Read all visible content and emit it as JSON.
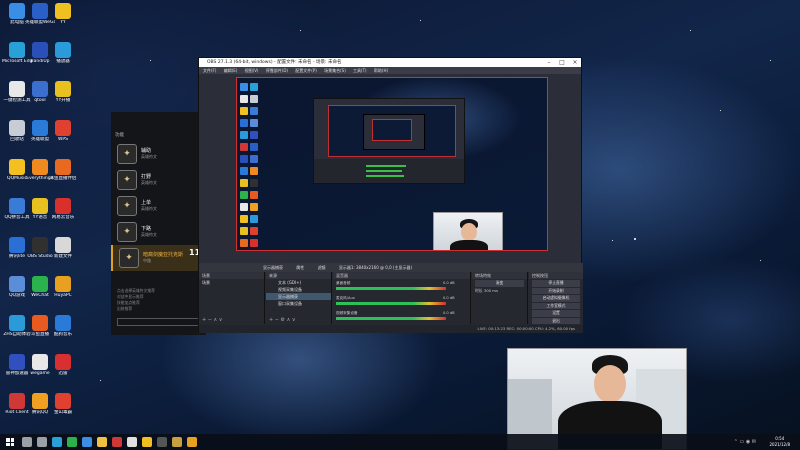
{
  "desktop": {
    "icons": [
      {
        "label": "此电脑",
        "color": "#3a8ee6"
      },
      {
        "label": "Microsoft Edge",
        "color": "#2aa0d8"
      },
      {
        "label": "一键检测工具",
        "color": "#e8e8e8"
      },
      {
        "label": "回收站",
        "color": "#c8ccd4"
      },
      {
        "label": "QQMusic",
        "color": "#f4c021"
      },
      {
        "label": "QQ拼音工具",
        "color": "#3a7bd5"
      },
      {
        "label": "腾讯lite",
        "color": "#2a6fd6"
      },
      {
        "label": "QQ游戏",
        "color": "#5b8dd9"
      },
      {
        "label": "ZHS自助体验",
        "color": "#2a9ad8"
      },
      {
        "label": "雷神加速器",
        "color": "#3050c0"
      },
      {
        "label": "Riot Client",
        "color": "#d03838"
      },
      {
        "label": "英雄联盟WeGame",
        "color": "#2a5fc8"
      },
      {
        "label": "BandiUp",
        "color": "#2a4fb8"
      },
      {
        "label": "qtool",
        "color": "#3a6fd0"
      },
      {
        "label": "英雄联盟",
        "color": "#2a7ad8"
      },
      {
        "label": "EverythingR",
        "color": "#f08a20"
      },
      {
        "label": "YY语音",
        "color": "#e8c020"
      },
      {
        "label": "OBS Studio",
        "color": "#303030"
      },
      {
        "label": "WeChat",
        "color": "#2bb24c"
      },
      {
        "label": "斗鱼直播",
        "color": "#e85a20"
      },
      {
        "label": "wegame",
        "color": "#e8e8e8"
      },
      {
        "label": "腾讯QQ",
        "color": "#f0a020"
      },
      {
        "label": "YY",
        "color": "#f0c020"
      },
      {
        "label": "播放器",
        "color": "#2a9ad8"
      },
      {
        "label": "YY开播",
        "color": "#e8c020"
      },
      {
        "label": "WPS",
        "color": "#e04030"
      },
      {
        "label": "斗鱼直播伴侣",
        "color": "#e86a20"
      },
      {
        "label": "网易云音乐",
        "color": "#d8302a"
      },
      {
        "label": "新建文件",
        "color": "#d8d8d8"
      },
      {
        "label": "HuyaPC",
        "color": "#e8a020"
      },
      {
        "label": "酷狗音乐",
        "color": "#2a7ad8"
      },
      {
        "label": "迅雷",
        "color": "#d83030"
      },
      {
        "label": "金山毒霸",
        "color": "#e04030"
      }
    ]
  },
  "launcher": {
    "header": "功能",
    "items": [
      {
        "title": "辅助",
        "subtitle": "英雄符文",
        "glyph": "✦",
        "active": false
      },
      {
        "title": "打野",
        "subtitle": "英雄符文",
        "glyph": "✦",
        "active": false
      },
      {
        "title": "上单",
        "subtitle": "英雄符文",
        "glyph": "✦",
        "active": false
      },
      {
        "title": "下路",
        "subtitle": "英雄符文",
        "glyph": "✦",
        "active": false
      },
      {
        "title": "暗裔剑魔亚托克斯",
        "subtitle": "中路",
        "glyph": "✦",
        "active": true
      }
    ],
    "footer_lines": [
      "点击选择英雄符文推荐",
      "对战中显示推荐",
      "技能加点推荐",
      "出装推荐"
    ],
    "number": "11"
  },
  "obs": {
    "title": "OBS 27.1.3 (64-bit, windows) - 配置文件: 未命名 - 场景: 未命名",
    "menu": [
      "文件(F)",
      "编辑(E)",
      "视图(V)",
      "停靠部件(D)",
      "配置文件(P)",
      "场景集合(S)",
      "工具(T)",
      "帮助(H)"
    ],
    "dock_tabs": [
      "显示器捕获",
      "属性",
      "滤镜",
      "显示器1: 3840x2160 @ 0,0 (主显示器)"
    ],
    "scenes": {
      "header": "场景",
      "items": [
        "场景"
      ]
    },
    "sources": {
      "header": "来源",
      "items": [
        "文本 (GDI+)",
        "视频采集设备",
        "显示器捕获",
        "窗口采集设备"
      ],
      "selected_index": 2
    },
    "mixer": {
      "header": "混音器",
      "channels": [
        {
          "name": "桌面音频",
          "level": "0.0 dB"
        },
        {
          "name": "麦克风/Aux",
          "level": "0.0 dB"
        },
        {
          "name": "视频采集设备",
          "level": "0.0 dB"
        }
      ]
    },
    "transitions": {
      "header": "转场特效",
      "type": "渐变",
      "duration_label": "时长",
      "duration": "300 ms"
    },
    "controls": {
      "header": "控制按钮",
      "buttons": [
        "停止直播",
        "开始录制",
        "启动虚拟摄像机",
        "工作室模式",
        "设置",
        "退出"
      ]
    },
    "status": "LIVE: 00:13:23  REC: 00:00:00  CPU: 4.2%, 60.00 fps"
  },
  "taskbar": {
    "icons": [
      {
        "name": "search-icon",
        "color": "#ffffff"
      },
      {
        "name": "task-view-icon",
        "color": "#ffffff"
      },
      {
        "name": "edge-icon",
        "color": "#2aa0d8"
      },
      {
        "name": "wechat-icon",
        "color": "#2bb24c"
      },
      {
        "name": "qq-icon",
        "color": "#3a8ee6"
      },
      {
        "name": "explorer-icon",
        "color": "#f0c040"
      },
      {
        "name": "riot-icon",
        "color": "#d03838"
      },
      {
        "name": "wegame-icon",
        "color": "#e0e0e0"
      },
      {
        "name": "yy-icon",
        "color": "#f0c020"
      },
      {
        "name": "obs-icon",
        "color": "#555555"
      },
      {
        "name": "lol-icon",
        "color": "#c8a040"
      },
      {
        "name": "huya-icon",
        "color": "#e8a020"
      }
    ],
    "time": "0:54",
    "date": "2021/12/8"
  }
}
